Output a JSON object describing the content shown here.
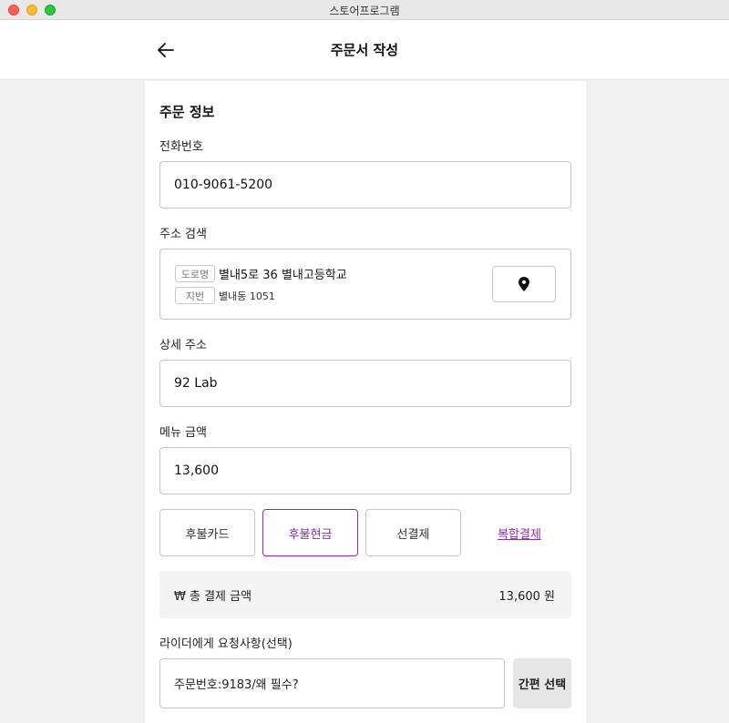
{
  "window": {
    "title": "스토어프로그램"
  },
  "header": {
    "title": "주문서 작성"
  },
  "form": {
    "section_title": "주문 정보",
    "phone": {
      "label": "전화번호",
      "value": "010-9061-5200"
    },
    "address": {
      "label": "주소 검색",
      "road_tag": "도로명",
      "road": "별내5로 36 별내고등학교",
      "jibun_tag": "지번",
      "jibun": "별내동 1051"
    },
    "detail_address": {
      "label": "상세 주소",
      "value": "92 Lab"
    },
    "menu_amount": {
      "label": "메뉴 금액",
      "value": "13,600"
    },
    "payment_methods": [
      {
        "label": "후불카드",
        "selected": false
      },
      {
        "label": "후불현금",
        "selected": true
      },
      {
        "label": "선결제",
        "selected": false
      }
    ],
    "complex_payment": "복합결제",
    "total": {
      "label": "₩ 총 결제 금액",
      "value": "13,600 원"
    },
    "request": {
      "label": "라이더에게 요청사항(선택)",
      "value": "주문번호:9183/왜 필수?"
    },
    "quick_select": "간편 선택"
  },
  "colors": {
    "accent": "#8a2ea6",
    "border": "#c6c6c6",
    "background": "#f0f0f0"
  },
  "icons": {
    "back": "arrow-left-icon",
    "map": "map-pin-icon"
  }
}
